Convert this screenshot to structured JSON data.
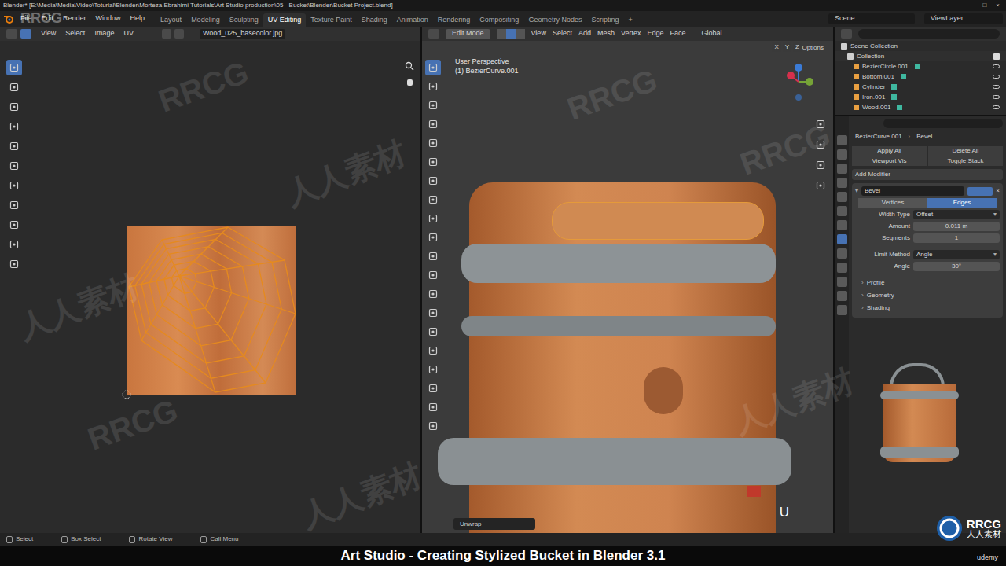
{
  "window": {
    "title": "Blender* [E:\\Media\\Media\\Video\\Toturial\\Blender\\Morteza Ebrahimi Tutorials\\Art Studio production\\05 - Bucket\\Blender\\Bucket Project.blend]",
    "controls": [
      "—",
      "□",
      "×"
    ]
  },
  "menu": [
    "File",
    "Edit",
    "Render",
    "Window",
    "Help"
  ],
  "workspaces": [
    {
      "label": "Layout",
      "selected": false
    },
    {
      "label": "Modeling",
      "selected": false
    },
    {
      "label": "Sculpting",
      "selected": false
    },
    {
      "label": "UV Editing",
      "selected": true
    },
    {
      "label": "Texture Paint",
      "selected": false
    },
    {
      "label": "Shading",
      "selected": false
    },
    {
      "label": "Animation",
      "selected": false
    },
    {
      "label": "Rendering",
      "selected": false
    },
    {
      "label": "Compositing",
      "selected": false
    },
    {
      "label": "Geometry Nodes",
      "selected": false
    },
    {
      "label": "Scripting",
      "selected": false
    }
  ],
  "workspace_add": "+",
  "scene": "Scene",
  "view_layer": "ViewLayer",
  "uv_editor": {
    "menu": [
      "View",
      "Select",
      "Image",
      "UV"
    ],
    "image": "Wood_025_basecolor.jpg"
  },
  "viewport": {
    "mode": "Edit Mode",
    "menu": [
      "View",
      "Select",
      "Add",
      "Mesh",
      "Vertex",
      "Edge",
      "Face"
    ],
    "orientation": "Global",
    "axes": [
      "X",
      "Y",
      "Z"
    ],
    "options": "Options",
    "perspective": "User Perspective",
    "object": "(1) BezierCurve.001",
    "operator": "Unwrap",
    "key": "U"
  },
  "outliner": {
    "root": "Scene Collection",
    "collection": "Collection",
    "items": [
      {
        "name": "BezierCircle.001",
        "visible": true
      },
      {
        "name": "Bottom.001",
        "visible": true
      },
      {
        "name": "Cylinder",
        "visible": true
      },
      {
        "name": "Iron.001",
        "visible": true
      },
      {
        "name": "Wood.001",
        "visible": true
      }
    ]
  },
  "properties": {
    "breadcrumb": [
      "BezierCurve.001",
      "Bevel"
    ],
    "buttons": [
      "Apply All",
      "Delete All",
      "Viewport Vis",
      "Toggle Stack"
    ],
    "add_modifier": "Add Modifier",
    "modifier": {
      "name": "Bevel",
      "close": "×",
      "affect": [
        {
          "label": "Vertices",
          "selected": false
        },
        {
          "label": "Edges",
          "selected": true
        }
      ],
      "field_groups": [
        [
          {
            "label": "Width Type",
            "value": "Offset",
            "kind": "dropdown"
          },
          {
            "label": "Amount",
            "value": "0.011 m",
            "kind": "number"
          },
          {
            "label": "Segments",
            "value": "1",
            "kind": "number"
          }
        ],
        [
          {
            "label": "Limit Method",
            "value": "Angle",
            "kind": "dropdown"
          },
          {
            "label": "Angle",
            "value": "30°",
            "kind": "number"
          }
        ]
      ],
      "panels": [
        {
          "label": "Profile",
          "expanded": false
        },
        {
          "label": "Geometry",
          "expanded": false
        },
        {
          "label": "Shading",
          "expanded": false
        }
      ]
    }
  },
  "status_bar": [
    "Select",
    "Box Select",
    "Rotate View",
    "Call Menu"
  ],
  "caption": "Art Studio - Creating Stylized Bucket in Blender 3.1",
  "brand": "udemy",
  "watermark": {
    "logo": "RRCG",
    "logo_sub": "人人素材",
    "corner": "RRCG",
    "marks": [
      "RRCG",
      "人人素材",
      "RRCG",
      "人人素材",
      "RRCG",
      "人人素材",
      "RRCG",
      "人人素材"
    ]
  }
}
